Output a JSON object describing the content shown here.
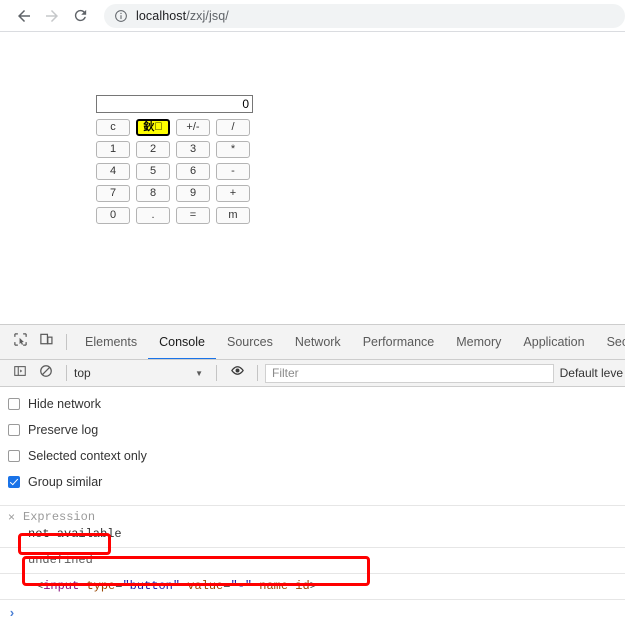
{
  "browser": {
    "nav": {
      "back_icon": "arrow-left-icon",
      "forward_icon": "arrow-right-icon",
      "reload_icon": "reload-icon"
    },
    "omnibox": {
      "security_icon": "info-circle-icon",
      "host": "localhost",
      "path": "/zxj/jsq/"
    }
  },
  "calculator": {
    "display_value": "0",
    "rows": [
      [
        {
          "label": "c",
          "highlight": false,
          "name": "calc-button-clear"
        },
        {
          "label": "鈥\u0000",
          "highlight": true,
          "name": "calc-button-mojibake"
        },
        {
          "label": "+/-",
          "highlight": false,
          "name": "calc-button-sign"
        },
        {
          "label": "/",
          "highlight": false,
          "name": "calc-button-divide"
        }
      ],
      [
        {
          "label": "1",
          "highlight": false,
          "name": "calc-button-1"
        },
        {
          "label": "2",
          "highlight": false,
          "name": "calc-button-2"
        },
        {
          "label": "3",
          "highlight": false,
          "name": "calc-button-3"
        },
        {
          "label": "*",
          "highlight": false,
          "name": "calc-button-multiply"
        }
      ],
      [
        {
          "label": "4",
          "highlight": false,
          "name": "calc-button-4"
        },
        {
          "label": "5",
          "highlight": false,
          "name": "calc-button-5"
        },
        {
          "label": "6",
          "highlight": false,
          "name": "calc-button-6"
        },
        {
          "label": "-",
          "highlight": false,
          "name": "calc-button-minus"
        }
      ],
      [
        {
          "label": "7",
          "highlight": false,
          "name": "calc-button-7"
        },
        {
          "label": "8",
          "highlight": false,
          "name": "calc-button-8"
        },
        {
          "label": "9",
          "highlight": false,
          "name": "calc-button-9"
        },
        {
          "label": "+",
          "highlight": false,
          "name": "calc-button-plus"
        }
      ],
      [
        {
          "label": "0",
          "highlight": false,
          "name": "calc-button-0"
        },
        {
          "label": ".",
          "highlight": false,
          "name": "calc-button-dot"
        },
        {
          "label": "=",
          "highlight": false,
          "name": "calc-button-equals"
        },
        {
          "label": "m",
          "highlight": false,
          "name": "calc-button-m"
        }
      ]
    ]
  },
  "devtools": {
    "inspect_icon": "inspect-element-icon",
    "device_icon": "device-toolbar-icon",
    "tabs": [
      {
        "label": "Elements",
        "active": false
      },
      {
        "label": "Console",
        "active": true
      },
      {
        "label": "Sources",
        "active": false
      },
      {
        "label": "Network",
        "active": false
      },
      {
        "label": "Performance",
        "active": false
      },
      {
        "label": "Memory",
        "active": false
      },
      {
        "label": "Application",
        "active": false
      },
      {
        "label": "Secu",
        "active": false
      }
    ],
    "console_toolbar": {
      "sidebar_icon": "console-sidebar-icon",
      "clear_icon": "clear-console-icon",
      "context": "top",
      "caret": "▼",
      "eye_icon": "live-expression-icon",
      "filter_placeholder": "Filter",
      "level": "Default leve"
    },
    "settings": [
      {
        "label": "Hide network",
        "checked": false
      },
      {
        "label": "Preserve log",
        "checked": false
      },
      {
        "label": "Selected context only",
        "checked": false
      },
      {
        "label": "Group similar",
        "checked": true
      }
    ],
    "messages": {
      "expression_x": "×",
      "expression_label": "Expression",
      "expression_value": "not available",
      "undefined_value": "undefined",
      "html_snippet": {
        "open_bracket": "<",
        "tag": "input",
        "attr1_name": " type",
        "attr1_eq": "=",
        "attr1_value": "\"button\"",
        "attr2_name": " value",
        "attr2_eq": "=",
        "attr2_value": "\"-\"",
        "attr3_name": " name",
        "attr4_name": " id",
        "close_bracket": ">"
      },
      "prompt_caret": "›"
    }
  },
  "annotations": {
    "color": "#ff0000",
    "boxes": [
      "undefined-result",
      "html-snippet"
    ]
  }
}
